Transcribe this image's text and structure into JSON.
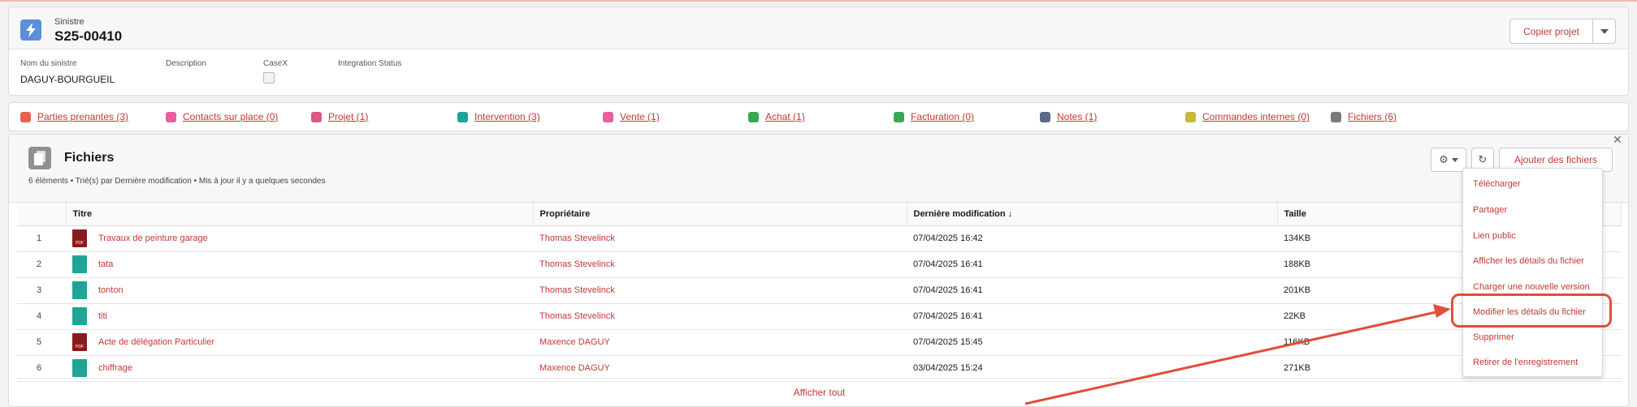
{
  "record": {
    "type_label": "Sinistre",
    "title": "S25-00410",
    "copy_button": "Copier projet",
    "fields": [
      {
        "label": "Nom du sinistre",
        "value": "DAGUY-BOURGUEIL"
      },
      {
        "label": "Description",
        "value": ""
      },
      {
        "label": "CaseX",
        "value": ""
      },
      {
        "label": "Integration Status",
        "value": ""
      }
    ]
  },
  "tabs": [
    {
      "label": "Parties prenantes (3)",
      "color": "#e8634b"
    },
    {
      "label": "Contacts sur place (0)",
      "color": "#e95f9d"
    },
    {
      "label": "Projet (1)",
      "color": "#e15486"
    },
    {
      "label": "Intervention (3)",
      "color": "#1aa39a"
    },
    {
      "label": "Vente (1)",
      "color": "#e95f9d"
    },
    {
      "label": "Achat (1)",
      "color": "#3ba755"
    },
    {
      "label": "Facturation (0)",
      "color": "#3ba755"
    },
    {
      "label": "Notes (1)",
      "color": "#5a6a85"
    },
    {
      "label": "Commandes internes (0)",
      "color": "#c5b83b"
    },
    {
      "label": "Fichiers (6)",
      "color": "#7a7a7a"
    }
  ],
  "files": {
    "title": "Fichiers",
    "subtitle": "6 éléments • Trié(s) par Dernière modification • Mis à jour il y a quelques secondes",
    "add_button": "Ajouter des fichiers",
    "columns": [
      "Titre",
      "Propriétaire",
      "Dernière modification ↓",
      "Taille"
    ],
    "rows": [
      {
        "num": "1",
        "type": "pdf",
        "title": "Travaux de peinture garage",
        "owner": "Thomas Stevelinck",
        "modified": "07/04/2025 16:42",
        "size": "134KB"
      },
      {
        "num": "2",
        "type": "img",
        "title": "tata",
        "owner": "Thomas Stevelinck",
        "modified": "07/04/2025 16:41",
        "size": "188KB"
      },
      {
        "num": "3",
        "type": "img",
        "title": "tonton",
        "owner": "Thomas Stevelinck",
        "modified": "07/04/2025 16:41",
        "size": "201KB"
      },
      {
        "num": "4",
        "type": "img",
        "title": "titi",
        "owner": "Thomas Stevelinck",
        "modified": "07/04/2025 16:41",
        "size": "22KB"
      },
      {
        "num": "5",
        "type": "pdf",
        "title": "Acte de délégation Particulier",
        "owner": "Maxence DAGUY",
        "modified": "07/04/2025 15:45",
        "size": "116KB"
      },
      {
        "num": "6",
        "type": "img",
        "title": "chiffrage",
        "owner": "Maxence DAGUY",
        "modified": "03/04/2025 15:24",
        "size": "271KB"
      }
    ],
    "show_all": "Afficher tout"
  },
  "menu": {
    "items": [
      "Télécharger",
      "Partager",
      "Lien public",
      "Afficher les détails du fichier",
      "Charger une nouvelle version",
      "Modifier les détails du fichier",
      "Supprimer",
      "Retirer de l'enregistrement"
    ],
    "highlighted": "Modifier les détails du fichier"
  },
  "colors": {
    "accent": "#c23934",
    "highlight": "#e04e3b"
  }
}
